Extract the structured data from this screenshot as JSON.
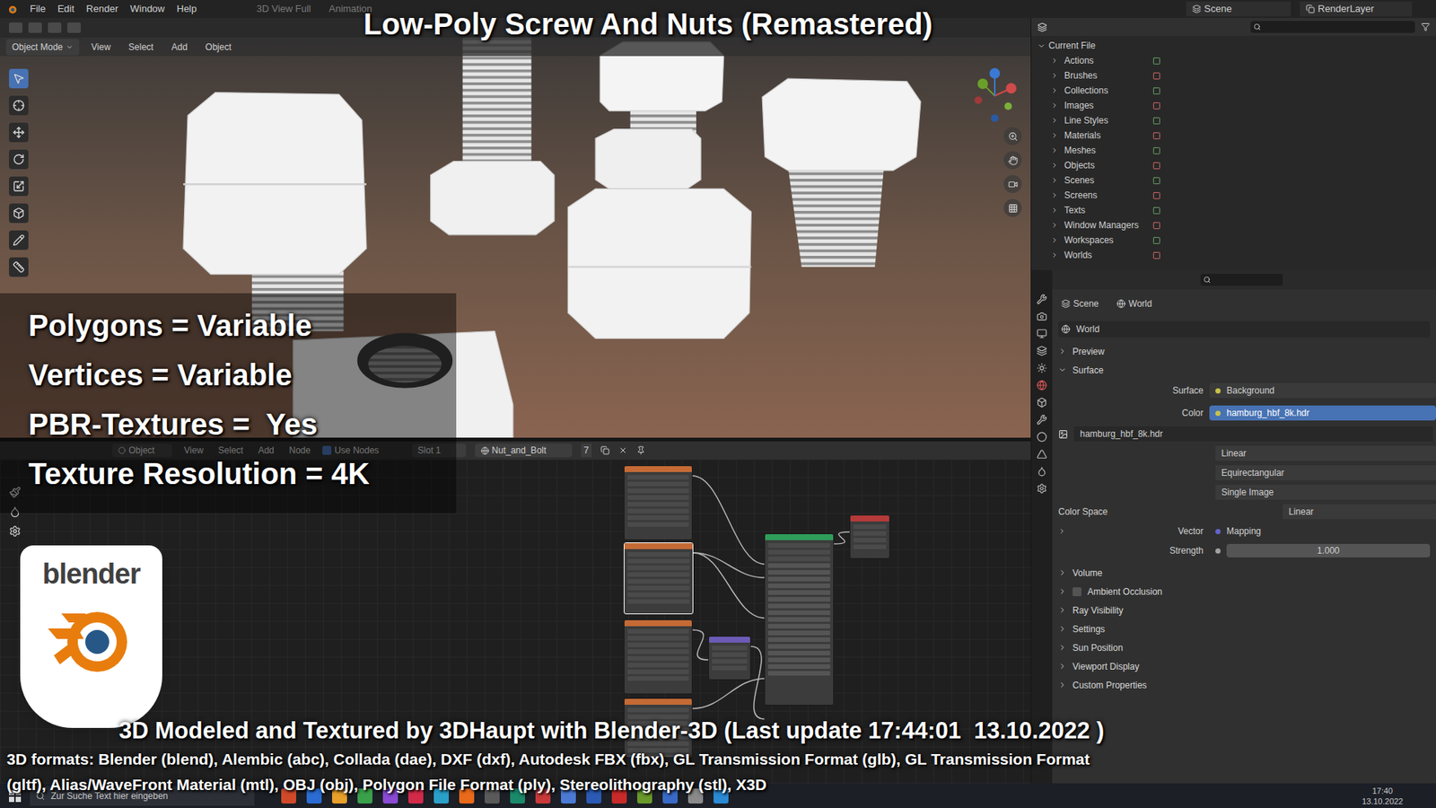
{
  "title": "Low-Poly Screw And Nuts (Remastered)",
  "top_bar": {
    "menu": [
      "File",
      "Edit",
      "Render",
      "Window",
      "Help"
    ],
    "workspaces": [
      "3D View Full",
      "Animation"
    ],
    "scene": "Scene",
    "render_layer": "RenderLayer"
  },
  "viewport": {
    "mode": "Object Mode",
    "menus": [
      "View",
      "Select",
      "Add",
      "Object"
    ]
  },
  "stats": [
    "Polygons = Variable",
    "Vertices = Variable",
    "PBR-Textures =  Yes",
    "Texture Resolution = 4K"
  ],
  "node_editor": {
    "mode": "Object",
    "menus": [
      "View",
      "Select",
      "Add",
      "Node"
    ],
    "use_nodes": {
      "label": "Use Nodes",
      "checked": true
    },
    "slot": "Slot 1",
    "material": "Nut_and_Bolt",
    "users": "7"
  },
  "nodes": [
    {
      "kind": "image",
      "color": "#c46a35",
      "selected": false
    },
    {
      "kind": "image",
      "color": "#c46a35",
      "selected": true
    },
    {
      "kind": "image",
      "color": "#c46a35",
      "selected": false
    },
    {
      "kind": "image",
      "color": "#c46a35",
      "selected": false
    },
    {
      "kind": "normal",
      "color": "#6b5bb5",
      "selected": false
    },
    {
      "kind": "shader",
      "color": "#2f9e5a",
      "selected": false
    },
    {
      "kind": "output",
      "color": "#b53a3a",
      "selected": false
    }
  ],
  "outliner": {
    "root": "Current File",
    "items": [
      "Actions",
      "Brushes",
      "Collections",
      "Images",
      "Line Styles",
      "Materials",
      "Meshes",
      "Objects",
      "Scenes",
      "Screens",
      "Texts",
      "Window Managers",
      "Workspaces",
      "Worlds"
    ]
  },
  "properties": {
    "breadcrumb": [
      "Scene",
      "World"
    ],
    "world": "World",
    "panels_top": [
      {
        "label": "Preview",
        "expanded": false
      },
      {
        "label": "Surface",
        "expanded": true
      }
    ],
    "fields": [
      {
        "label": "Surface",
        "value": "Background",
        "highlighted": false
      },
      {
        "label": "Color",
        "value": "hamburg_hbf_8k.hdr",
        "highlighted": true
      }
    ],
    "image": "hamburg_hbf_8k.hdr",
    "options": [
      "Linear",
      "Equirectangular",
      "Single Image"
    ],
    "color_space": {
      "label": "Color Space",
      "value": "Linear"
    },
    "vector": {
      "label": "Vector",
      "value": "Mapping"
    },
    "strength": {
      "label": "Strength",
      "value": "1.000"
    },
    "panels_bottom": [
      {
        "label": "Volume",
        "kind": "plain",
        "checked": false
      },
      {
        "label": "Ambient Occlusion",
        "kind": "checkbox",
        "checked": false
      },
      {
        "label": "Ray Visibility",
        "kind": "plain",
        "checked": false
      },
      {
        "label": "Settings",
        "kind": "plain",
        "checked": false
      },
      {
        "label": "Sun Position",
        "kind": "plain",
        "checked": false
      },
      {
        "label": "Viewport Display",
        "kind": "plain",
        "checked": false
      },
      {
        "label": "Custom Properties",
        "kind": "plain",
        "checked": false
      }
    ]
  },
  "logo": "blender",
  "caption": "3D Modeled and Textured by 3DHaupt with Blender-3D (Last update 17:44:01  13.10.2022 )",
  "formats": [
    "3D formats: Blender (blend), Alembic (abc), Collada (dae), DXF (dxf), Autodesk FBX (fbx), GL Transmission Format (glb), GL Transmission Format",
    "(gltf), Alias/WaveFront Material (mtl), OBJ (obj), Polygon File Format (ply), Stereolithography (stl), X3D"
  ],
  "taskbar": {
    "search": "Zur Suche Text hier eingeben",
    "time": "17:40",
    "date": "13.10.2022"
  }
}
